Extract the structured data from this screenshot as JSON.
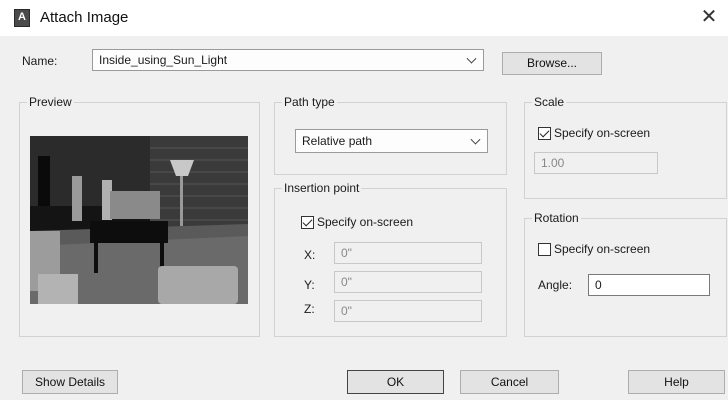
{
  "window": {
    "title": "Attach Image",
    "icon": "autocad-app-icon",
    "close_glyph": "✕"
  },
  "name": {
    "label": "Name:",
    "value": "Inside_using_Sun_Light",
    "browse_label": "Browse..."
  },
  "preview": {
    "title": "Preview"
  },
  "path_type": {
    "title": "Path type",
    "value": "Relative path"
  },
  "insertion": {
    "title": "Insertion point",
    "specify_label": "Specify on-screen",
    "specify_checked": true,
    "x_label": "X:",
    "x_value": "0\"",
    "y_label": "Y:",
    "y_value": "0\"",
    "z_label": "Z:",
    "z_value": "0\""
  },
  "scale": {
    "title": "Scale",
    "specify_label": "Specify on-screen",
    "specify_checked": true,
    "value": "1.00"
  },
  "rotation": {
    "title": "Rotation",
    "specify_label": "Specify on-screen",
    "specify_checked": false,
    "angle_label": "Angle:",
    "angle_value": "0"
  },
  "buttons": {
    "details": "Show Details",
    "ok": "OK",
    "cancel": "Cancel",
    "help": "Help"
  }
}
